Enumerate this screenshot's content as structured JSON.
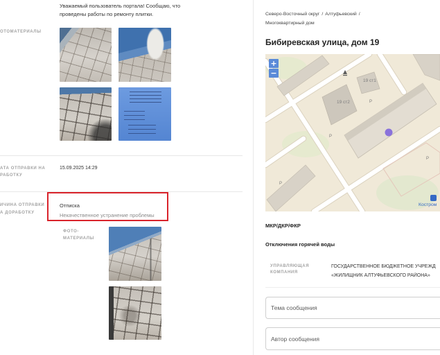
{
  "report": {
    "message_lines": [
      "Уважаемый пользователь портала! Сообщаю, что",
      "проведены работы по ремонту плитки."
    ],
    "photos_label": "ОТОМАТЕРИАЛЫ"
  },
  "revision_date": {
    "label_lines": [
      "АТА ОТПРАВКИ НА",
      "РАБОТКУ"
    ],
    "value": "15.09.2025 14:29"
  },
  "revision_reason": {
    "label_lines": [
      "ИЧИНА ОТПРАВКИ",
      "А ДОРАБОТКУ"
    ],
    "title": "Отписка",
    "description": "Некачественное устранение проблемы",
    "photos_label_lines": [
      "ФОТО-",
      "МАТЕРИАЛЫ"
    ]
  },
  "address": {
    "breadcrumb": {
      "items": [
        "Северо-Восточный округ",
        "Алтуфьевский",
        "Многоквартирный дом"
      ],
      "separator": "/"
    },
    "title": "Бибиревская улица, дом 19",
    "map": {
      "zoom_in_label": "+",
      "zoom_out_label": "−",
      "building_labels": [
        "19 ст1",
        "19 ст2"
      ],
      "parking_markers": [
        "P",
        "P",
        "P",
        "P"
      ],
      "attribution": "Костром",
      "icons": {
        "landmark": "landmark-icon",
        "attribution": "map-provider-logo-icon"
      }
    },
    "program": "МКР/ДКР/ФКР",
    "outage": "Отключения горячей воды",
    "management_company": {
      "label_lines": [
        "УПРАВЛЯЮЩАЯ",
        "КОМПАНИЯ"
      ],
      "value_lines": [
        "ГОСУДАРСТВЕННОЕ БЮДЖЕТНОЕ УЧРЕЖД",
        "«ЖИЛИЩНИК АЛТУФЬЕВСКОГО РАЙОНА»"
      ]
    }
  },
  "message_form": {
    "subject_placeholder": "Тема сообщения",
    "author_placeholder": "Автор сообщения"
  },
  "colors": {
    "highlight": "#d9232b",
    "map_marker": "#8a72db",
    "zoom_button": "#5a8ad8",
    "attribution": "#3569c5"
  }
}
